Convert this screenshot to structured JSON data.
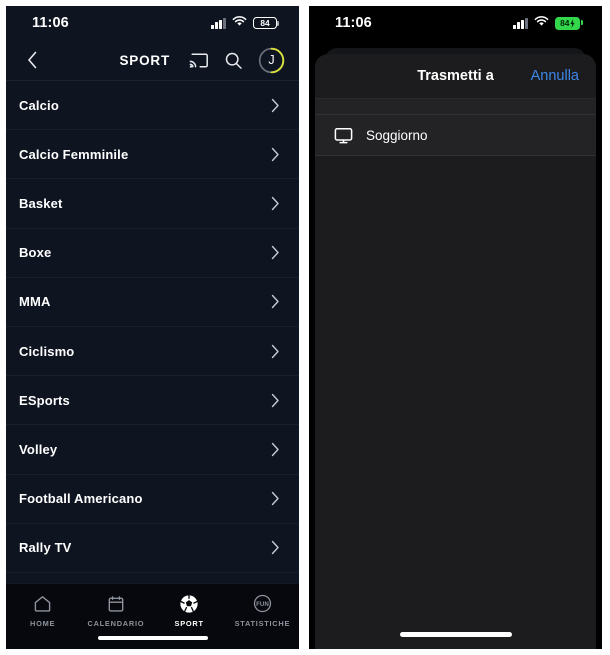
{
  "left_phone": {
    "status_bar": {
      "time": "11:06",
      "signal_icon": "cellular-bars-icon",
      "wifi_icon": "wifi-icon",
      "battery_icon": "battery-icon",
      "battery_level": "84",
      "battery_charging": false
    },
    "header": {
      "back_icon": "back-chevron-icon",
      "title": "SPORT",
      "cast_icon": "cast-icon",
      "search_icon": "search-icon",
      "avatar_initial": "J",
      "avatar_ring_color": "#d7e03b",
      "avatar_track_color": "#6a6f78"
    },
    "sport_list": [
      {
        "label": "Calcio",
        "chevron": "chevron-right-icon"
      },
      {
        "label": "Calcio Femminile",
        "chevron": "chevron-right-icon"
      },
      {
        "label": "Basket",
        "chevron": "chevron-right-icon"
      },
      {
        "label": "Boxe",
        "chevron": "chevron-right-icon"
      },
      {
        "label": "MMA",
        "chevron": "chevron-right-icon"
      },
      {
        "label": "Ciclismo",
        "chevron": "chevron-right-icon"
      },
      {
        "label": "ESports",
        "chevron": "chevron-right-icon"
      },
      {
        "label": "Volley",
        "chevron": "chevron-right-icon"
      },
      {
        "label": "Football Americano",
        "chevron": "chevron-right-icon"
      },
      {
        "label": "Rally TV",
        "chevron": "chevron-right-icon"
      }
    ],
    "tab_bar": [
      {
        "label": "HOME",
        "icon": "home-icon",
        "active": false
      },
      {
        "label": "CALENDARIO",
        "icon": "calendar-icon",
        "active": false
      },
      {
        "label": "SPORT",
        "icon": "soccer-ball-icon",
        "active": true
      },
      {
        "label": "STATISTICHE",
        "icon": "fun-stats-icon",
        "active": false
      }
    ],
    "tab_stats_icon_text": "FUN"
  },
  "right_phone": {
    "status_bar": {
      "time": "11:06",
      "signal_icon": "cellular-bars-icon",
      "wifi_icon": "wifi-icon",
      "battery_icon": "battery-charging-icon",
      "battery_level": "84",
      "battery_charging": true,
      "battery_color": "#32d74b"
    },
    "cast_sheet": {
      "title": "Trasmetti a",
      "cancel_label": "Annulla",
      "cancel_color": "#3d87e8",
      "devices": [
        {
          "name": "Soggiorno",
          "icon": "tv-monitor-icon"
        }
      ]
    }
  }
}
